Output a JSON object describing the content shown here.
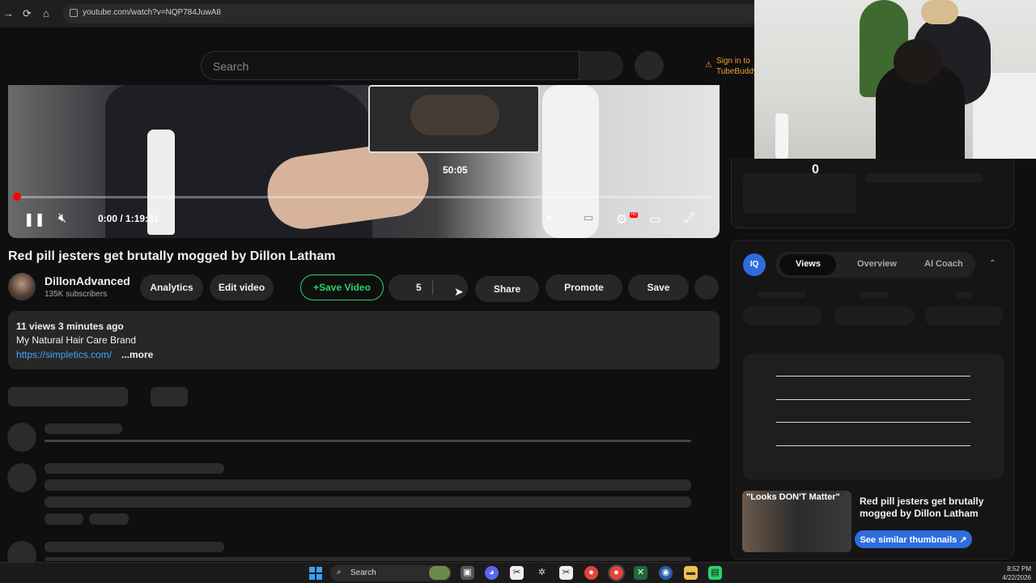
{
  "browser": {
    "url": "youtube.com/watch?v=NQP784JuwA8"
  },
  "youtube_header": {
    "search_placeholder": "Search",
    "tubebuddy_line1": "Sign in to",
    "tubebuddy_line2": "TubeBuddy"
  },
  "player": {
    "preview_time": "50:05",
    "time_display": "0:00 / 1:19:31",
    "progress_fraction": 0.0
  },
  "video": {
    "title": "Red pill jesters get brutally mogged by Dillon Latham",
    "channel_name": "DillonAdvanced",
    "subscribers": "135K subscribers",
    "actions": {
      "analytics": "Analytics",
      "edit_video": "Edit video",
      "save_video_ext": "+Save Video",
      "like_count": "5",
      "share": "Share",
      "promote": "Promote",
      "save": "Save"
    },
    "description": {
      "meta": "11 views  3 minutes ago",
      "line": "My Natural Hair Care Brand",
      "link": "https://simpletics.com/",
      "more": "...more"
    }
  },
  "side_panel": {
    "top_value": "0",
    "logo_text": "IQ",
    "tabs": [
      "Views",
      "Overview",
      "AI Coach"
    ],
    "active_tab": "Views",
    "similar": {
      "thumb_text": "\"Looks DON'T Matter\"",
      "title": "Red pill jesters get brutally mogged by Dillon Latham",
      "button": "See similar thumbnails ↗"
    }
  },
  "taskbar": {
    "search_label": "Search",
    "time": "8:52 PM",
    "date": "4/22/2026"
  },
  "colors": {
    "accent_blue": "#2f6dde",
    "save_video_green": "#2bd36a",
    "link_blue": "#3ea6ff",
    "progress_red": "#ff0000",
    "tubebuddy_orange": "#f0a030"
  }
}
